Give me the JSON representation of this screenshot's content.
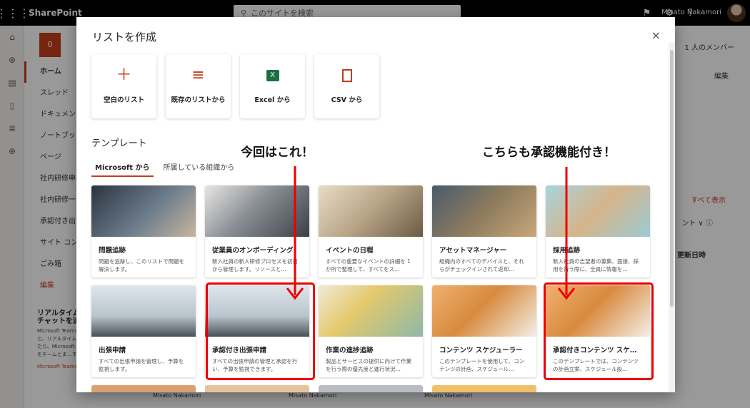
{
  "suitebar": {
    "app_name": "SharePoint",
    "search_placeholder": "このサイトを検索",
    "user_name": "Misato Nakamori"
  },
  "site": {
    "logo_letter": "0",
    "nav": [
      "ホーム",
      "スレッド",
      "ドキュメント",
      "ノートブック",
      "ページ",
      "社内研修申請",
      "社内研修一覧",
      "承認付き出張申請",
      "サイト コンテンツ",
      "ごみ箱",
      "編集"
    ],
    "members": "1 人のメンバー",
    "edit": "編集",
    "show_all": "すべて表示",
    "updated_sort": "更新日時",
    "promo_title": "リアルタイムでチャットを追加",
    "promo_text": "Microsoft Teams と、リアルタイムで…たり、Microsoft…スをチームとま…す。",
    "promo_link": "Microsoft Teams",
    "feed": [
      "Misato Nakamori",
      "Misato Nakamori",
      "Misato Nakamori"
    ]
  },
  "modal": {
    "title": "リストを作成",
    "close_label": "×",
    "create_options": [
      {
        "label": "空白のリスト",
        "icon": "plus-icon"
      },
      {
        "label": "既存のリストから",
        "icon": "list-icon"
      },
      {
        "label": "Excel から",
        "icon": "excel-icon"
      },
      {
        "label": "CSV から",
        "icon": "csv-icon"
      }
    ],
    "templates_heading": "テンプレート",
    "tabs": [
      "Microsoft から",
      "所属している組織から"
    ],
    "templates": [
      {
        "name": "問題追跡",
        "desc": "問題を追跡し、このリストで問題を解決します。"
      },
      {
        "name": "従業員のオンボーディング",
        "desc": "新入社員の新人研修プロセスを初日から管理します。リソースと…"
      },
      {
        "name": "イベントの日程",
        "desc": "すべての重要なイベントの詳細を 1 か所で整理して、すべてをス…"
      },
      {
        "name": "アセットマネージャー",
        "desc": "組織内のすべてのデバイスと、それらがチェックインされて返却…"
      },
      {
        "name": "採用追跡",
        "desc": "新入社員の志望者の募集、面接、採用を行う際に、全員に情報を…"
      },
      {
        "name": "出張申請",
        "desc": "すべての出張申請を管理し、予算を監視します。"
      },
      {
        "name": "承認付き出張申請",
        "desc": "すべての出張申請の管理と承認を行い、予算を監視できます。"
      },
      {
        "name": "作業の進捗追跡",
        "desc": "製品とサービスの提供に向けて作業を行う際の優先度と進行状況…"
      },
      {
        "name": "コンテンツ スケジューラー",
        "desc": "このテンプレートを使用して、コンテンツの計画、スケジュール…"
      },
      {
        "name": "承認付きコンテンツ スケジ…",
        "desc": "このテンプレートでは、コンテンツの計画立案、スケジュール設…"
      }
    ]
  },
  "annotations": {
    "left": "今回はこれ！",
    "right": "こちらも承認機能付き！"
  }
}
